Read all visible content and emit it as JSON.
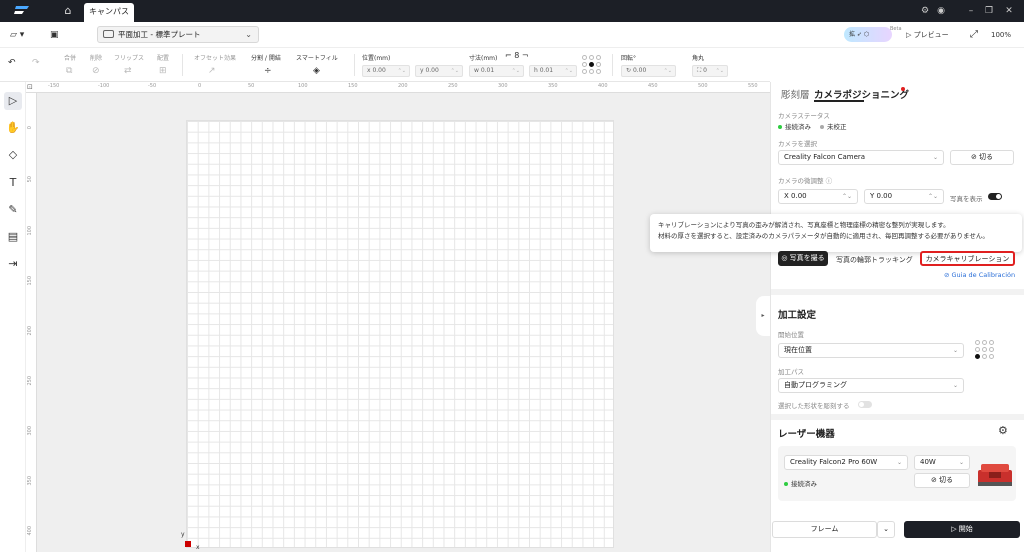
{
  "titlebar": {
    "tab": "キャンパス"
  },
  "toolbar": {
    "plate": "平面加工 - 標準プレート",
    "beta_label": "Beta",
    "preview": "プレビュー",
    "zoom": "100%"
  },
  "toolbar2": {
    "group": "合併",
    "delete": "削除",
    "flip": "フリップス",
    "arrange": "配置",
    "offset": "オフセット効果",
    "split": "分割 / 開結",
    "smartfill": "スマートフィル",
    "position_label": "位置(mm)",
    "pos_x": "x 0.00",
    "pos_y": "y 0.00",
    "size_label": "寸法(mm)",
    "size_w": "w 0.01",
    "size_h": "h 0.01",
    "rotate_label": "回転°",
    "rotate_value": "0.00",
    "corner_label": "角丸",
    "corner_value": "0"
  },
  "ruler": {
    "top": [
      "-150",
      "-100",
      "-50",
      "0",
      "50",
      "100",
      "150",
      "200",
      "250",
      "300",
      "350",
      "400",
      "450",
      "500",
      "550"
    ],
    "left": [
      "0",
      "50",
      "100",
      "150",
      "200",
      "250",
      "300",
      "350",
      "400"
    ]
  },
  "axes": {
    "y": "y",
    "x": "x"
  },
  "panel": {
    "tab_engrave": "彫刻層",
    "tab_camera": "カメラポジショニング",
    "camera_status_label": "カメラステータス",
    "status_connected": "接続済み",
    "status_uncalibrated": "未校正",
    "camera_select_label": "カメラを選択",
    "camera_name": "Creality Falcon Camera",
    "cut_button": "切る",
    "camera_offset_label": "カメラの微調整",
    "offset_x": "X 0.00",
    "offset_y": "Y 0.00",
    "show_photo": "写真を表示",
    "take_photo": "写真を撮る",
    "contour_tracking": "写真の輪郭トラッキング",
    "calibration": "カメラキャリブレーション",
    "calibration_guide": "Guia de Calibración",
    "tooltip_line1": "キャリブレーションにより写真の歪みが解消され、写真座標と物理座標の精密な整列が実現します。",
    "tooltip_line2": "材料の厚さを選択すると、設定済みのカメラパラメータが自動的に適用され、毎回再調整する必要がありません。",
    "processing_title": "加工設定",
    "start_position_label": "開始位置",
    "start_position": "現在位置",
    "path_label": "加工パス",
    "path_value": "自動プログラミング",
    "engrave_selected": "選択した形状を彫刻する",
    "laser_title": "レーザー機器",
    "laser_model": "Creality Falcon2 Pro 60W",
    "laser_power": "40W",
    "laser_status": "接続済み",
    "laser_cut": "切る",
    "frame_button": "フレーム",
    "start_button": "開始"
  },
  "colors": {
    "accent_red": "#e02020",
    "connected_green": "#2ecc40",
    "dark": "#1c1f26"
  }
}
